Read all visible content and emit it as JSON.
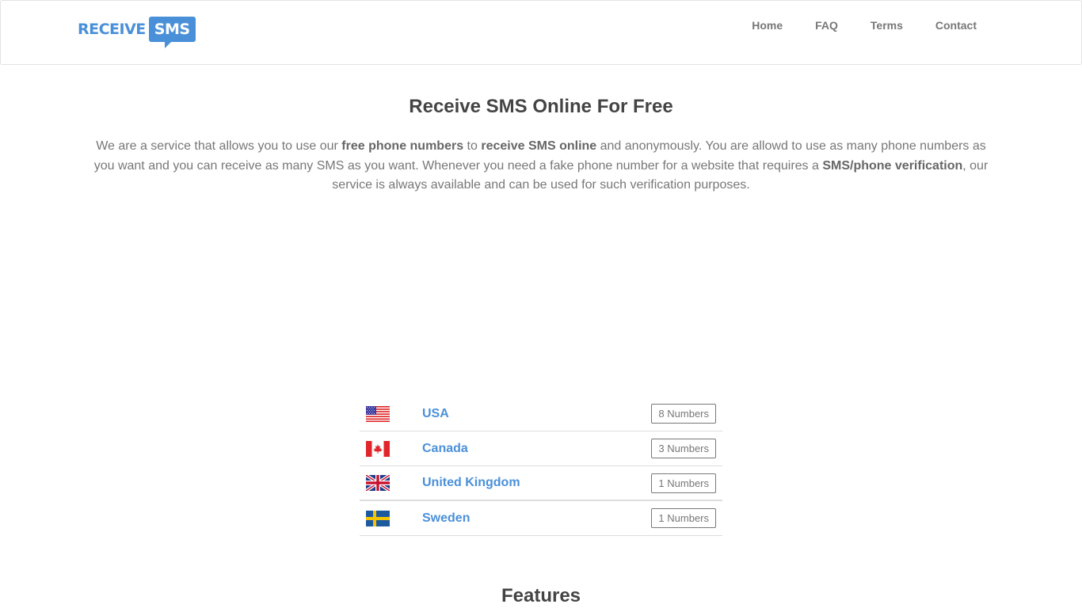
{
  "header": {
    "logo": {
      "text_left": "RECEIVE",
      "text_right": "SMS"
    },
    "nav": [
      {
        "label": "Home"
      },
      {
        "label": "FAQ"
      },
      {
        "label": "Terms"
      },
      {
        "label": "Contact"
      }
    ]
  },
  "main": {
    "title": "Receive SMS Online For Free",
    "intro": {
      "p1": "We are a service that allows you to use our ",
      "b1": "free phone numbers",
      "p2": " to ",
      "b2": "receive SMS online",
      "p3": " and anonymously. You are allowd to use as many phone numbers as you want and you can receive as many SMS as you want. Whenever you need a fake phone number for a website that requires a ",
      "b3": "SMS/phone verification",
      "p4": ", our service is always available and can be used for such verification purposes."
    },
    "countries": [
      {
        "name": "USA",
        "flag": "us-flag-icon",
        "count": "8 Numbers"
      },
      {
        "name": "Canada",
        "flag": "canada-flag-icon",
        "count": "3 Numbers"
      },
      {
        "name": "United Kingdom",
        "flag": "uk-flag-icon",
        "count": "1 Numbers"
      },
      {
        "name": "Sweden",
        "flag": "sweden-flag-icon",
        "count": "1 Numbers"
      }
    ],
    "features_heading": "Features"
  },
  "colors": {
    "brand": "#4a90d9",
    "heading": "#444444",
    "text": "#777777"
  }
}
